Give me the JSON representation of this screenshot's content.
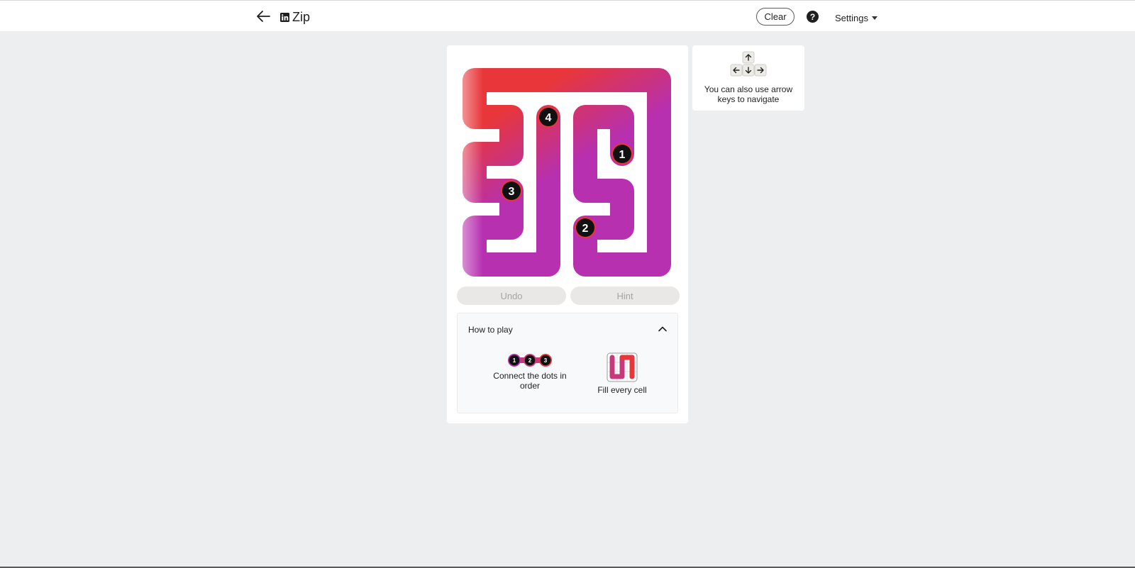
{
  "header": {
    "app_title": "Zip",
    "clear_label": "Clear",
    "help_label": "?",
    "settings_label": "Settings"
  },
  "puzzle": {
    "grid_cols": 6,
    "grid_rows": 6,
    "path": [
      [
        4,
        2
      ],
      [
        4,
        1
      ],
      [
        5,
        0
      ],
      [
        5,
        0
      ],
      [
        4,
        0
      ],
      [
        3,
        0
      ],
      [
        2,
        0
      ],
      [
        1,
        0
      ],
      [
        0,
        0
      ],
      [
        0,
        1
      ],
      [
        1,
        1
      ],
      [
        1,
        2
      ],
      [
        0,
        2
      ],
      [
        0,
        3
      ],
      [
        1,
        3
      ],
      [
        1,
        4
      ],
      [
        0,
        4
      ],
      [
        0,
        5
      ],
      [
        1,
        5
      ],
      [
        2,
        5
      ],
      [
        2,
        4
      ],
      [
        2,
        3
      ],
      [
        2,
        2
      ],
      [
        2,
        1
      ]
    ],
    "dots": [
      {
        "label": "1",
        "col": 4,
        "row": 2
      },
      {
        "label": "2",
        "col": 3,
        "row": 4
      },
      {
        "label": "3",
        "col": 1,
        "row": 3
      },
      {
        "label": "4",
        "col": 2,
        "row": 1
      }
    ],
    "colors": {
      "start": "#b630b0",
      "end": "#e8363a",
      "dot_fill": "#111111",
      "dot_ring": "#e8363a"
    }
  },
  "controls": {
    "undo_label": "Undo",
    "hint_label": "Hint"
  },
  "how_to_play": {
    "title": "How to play",
    "connect_label": "Connect the dots in order",
    "fill_label": "Fill every cell",
    "connect_dots": [
      "1",
      "2",
      "3"
    ]
  },
  "keys_hint": {
    "text": "You can also use arrow keys to navigate"
  }
}
